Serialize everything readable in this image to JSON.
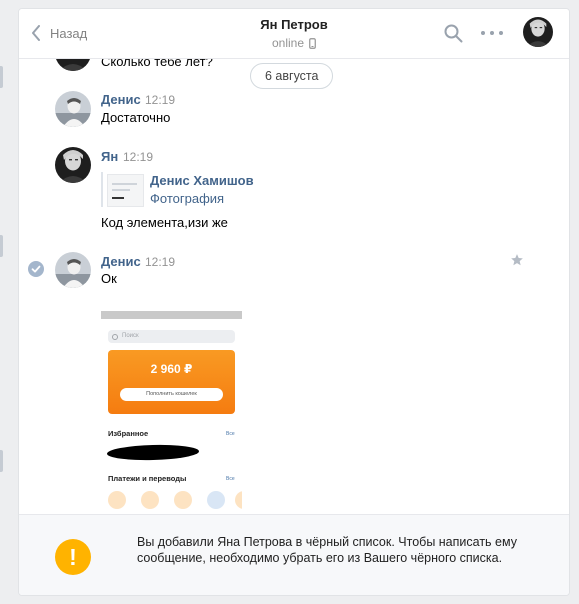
{
  "header": {
    "back_label": "Назад",
    "title": "Ян Петров",
    "status": "online"
  },
  "chat": {
    "date_divider": "6 августа",
    "partial_message": {
      "text": "Сколько тебе лет?"
    },
    "messages": [
      {
        "author": "Денис",
        "time": "12:19",
        "text": "Достаточно"
      },
      {
        "author": "Ян",
        "time": "12:19",
        "forward": {
          "name": "Денис Хамишов",
          "subtitle": "Фотография"
        },
        "text": "Код элемента,изи же"
      },
      {
        "author": "Денис",
        "time": "12:19",
        "text": "Ок"
      }
    ]
  },
  "photo_preview": {
    "search_placeholder": "Поиск",
    "balance": "2 960 ₽",
    "topup_label": "Пополнить кошелек",
    "favorites_title": "Избранное",
    "favorites_all": "Все",
    "payments_title": "Платежи и переводы",
    "payments_all": "Все"
  },
  "blacklist_notice": {
    "text": "Вы добавили Яна Петрова в чёрный список. Чтобы написать ему сообщение, необходимо убрать его из Вашего чёрного списка.",
    "icon_text": "!"
  },
  "colors": {
    "accent": "#42648b",
    "card_orange": "#f78a1a",
    "warning": "#ffb300"
  },
  "icons": [
    "chevron-left-icon",
    "phone-icon",
    "search-icon",
    "more-icon",
    "check-circle-icon",
    "star-icon",
    "warning-icon"
  ]
}
